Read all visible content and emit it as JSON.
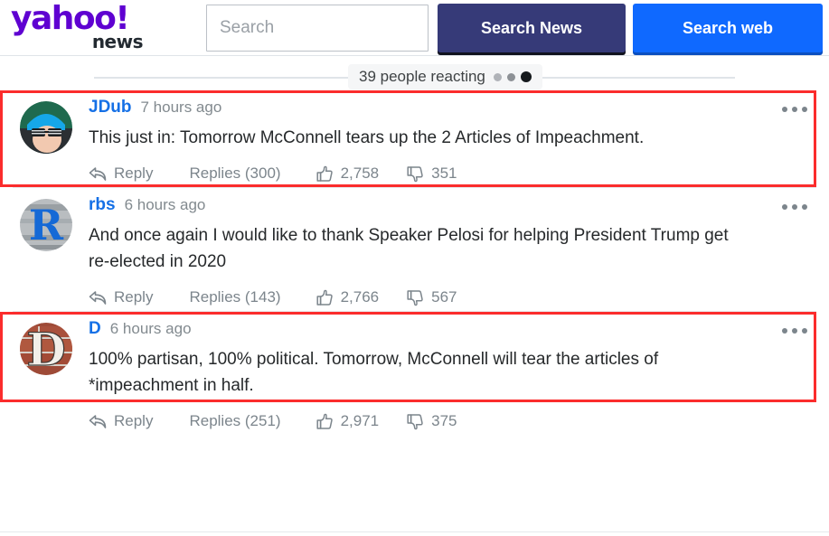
{
  "header": {
    "logo_primary": "yahoo!",
    "logo_secondary": "news",
    "search": {
      "placeholder": "Search",
      "value": ""
    },
    "buttons": {
      "search_news": "Search News",
      "search_web": "Search web"
    },
    "colors": {
      "logo_purple": "#5f01d1",
      "search_news_bg": "#363a78",
      "search_web_bg": "#0f69ff"
    }
  },
  "reacting_bar": {
    "label": "39 people reacting",
    "count": 39,
    "dots": [
      "#b0b3b8",
      "#8d9196",
      "#15191c"
    ]
  },
  "annotation": {
    "highlight_color": "#fb2c2c",
    "boxes": 2
  },
  "comments": [
    {
      "username": "JDub",
      "timestamp": "7 hours ago",
      "text": "This just in: Tomorrow McConnell tears up the 2 Articles of Impeachment.",
      "reply_label": "Reply",
      "replies_label": "Replies (300)",
      "replies_count": 300,
      "upvotes": "2,758",
      "downvotes": "351",
      "highlighted": true
    },
    {
      "username": "rbs",
      "timestamp": "6 hours ago",
      "text": "And once again I would like to thank Speaker Pelosi for helping President Trump get re-elected in 2020",
      "reply_label": "Reply",
      "replies_label": "Replies (143)",
      "replies_count": 143,
      "upvotes": "2,766",
      "downvotes": "567",
      "highlighted": false
    },
    {
      "username": "D",
      "timestamp": "6 hours ago",
      "text": "100% partisan, 100% political. Tomorrow, McConnell will tear the articles of *impeachment in half.",
      "reply_label": "Reply",
      "replies_label": "Replies (251)",
      "replies_count": 251,
      "upvotes": "2,971",
      "downvotes": "375",
      "highlighted": true
    }
  ],
  "icons": {
    "reply": "reply-arrow-icon",
    "thumbs_up": "thumbs-up-icon",
    "thumbs_down": "thumbs-down-icon",
    "kebab": "more-options-icon"
  }
}
